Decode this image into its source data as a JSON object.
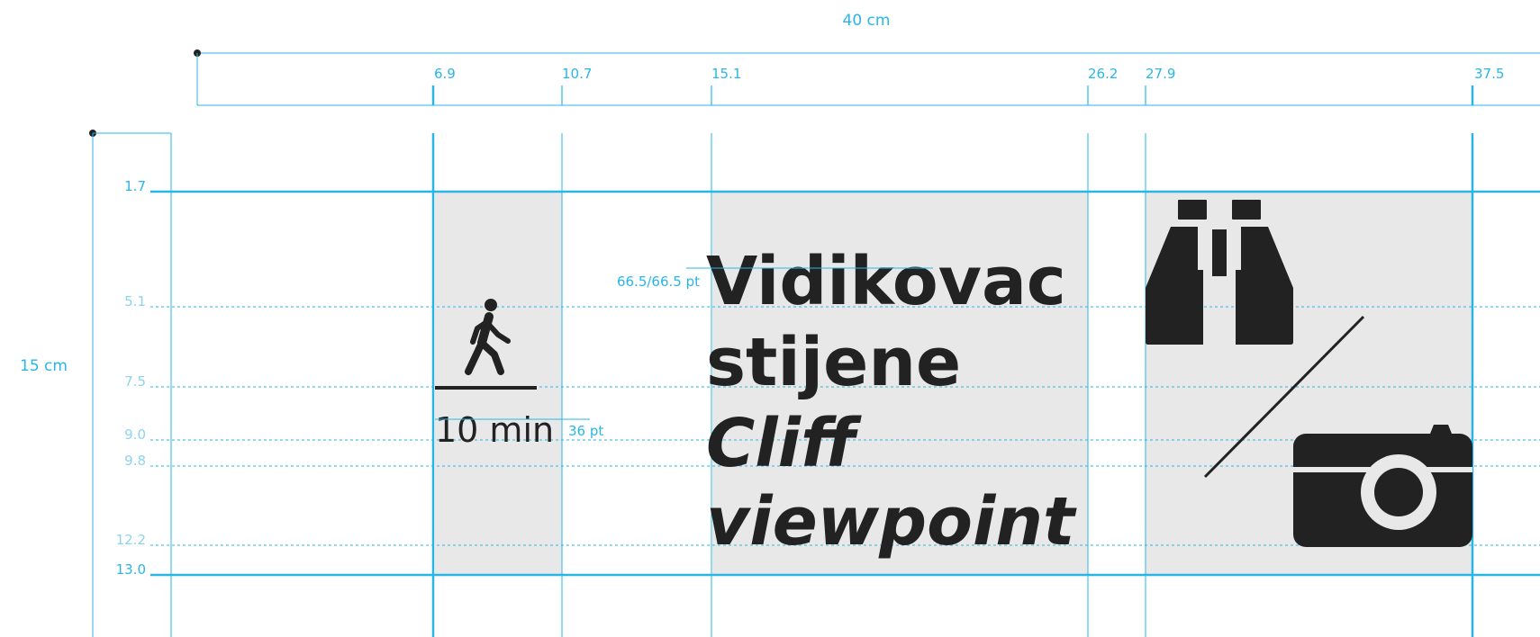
{
  "dimensions": {
    "width_label": "40 cm",
    "height_label": "15 cm",
    "top_ticks": [
      "6.9",
      "10.7",
      "15.1",
      "26.2",
      "27.9",
      "37.5"
    ],
    "side_ticks": [
      "1.7",
      "5.1",
      "7.5",
      "9.0",
      "9.8",
      "12.2",
      "13.0"
    ]
  },
  "annotations": {
    "title_size": "66.5/66.5 pt",
    "time_size": "36 pt"
  },
  "sign": {
    "time": "10 min",
    "title_line1": "Vidikovac",
    "title_line2": "stijene",
    "title_line3": "Cliff",
    "title_line4": "viewpoint"
  },
  "icons": [
    "pedestrian-icon",
    "binoculars-icon",
    "camera-icon"
  ],
  "colors": {
    "guide": "#29b6e6",
    "panel": "#e8e8e8",
    "ink": "#222222"
  }
}
